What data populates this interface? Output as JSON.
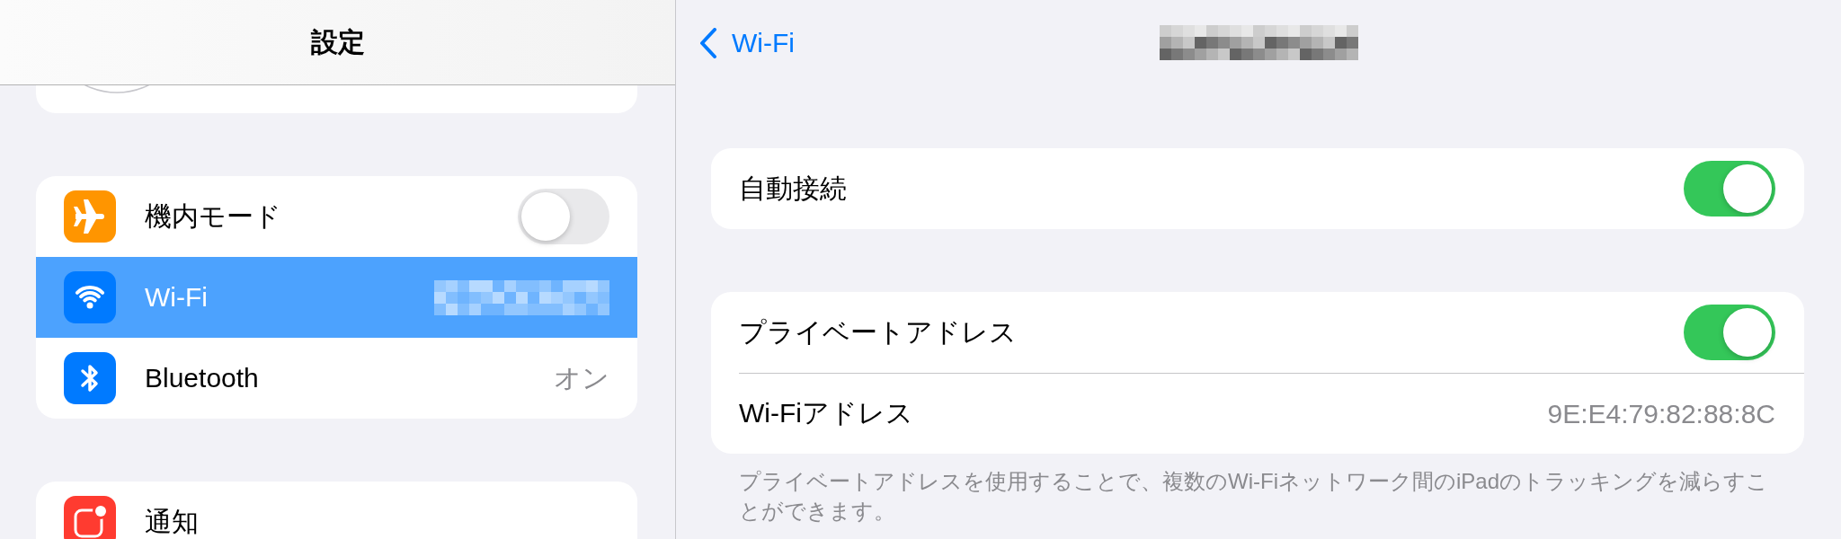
{
  "sidebar": {
    "title": "設定",
    "groups": [
      {
        "items": [
          {
            "kind": "toggle",
            "label": "機内モード",
            "color": "#ff9500",
            "on": false,
            "selected": false
          },
          {
            "kind": "link",
            "label": "Wi-Fi",
            "color": "#007aff",
            "value_blurred": true,
            "selected": true
          },
          {
            "kind": "link",
            "label": "Bluetooth",
            "color": "#007aff",
            "value": "オン",
            "selected": false
          }
        ]
      },
      {
        "items": [
          {
            "kind": "link",
            "label": "通知",
            "color": "#ff3b30",
            "selected": false
          }
        ]
      }
    ]
  },
  "detail": {
    "back": "Wi-Fi",
    "title_blurred": true,
    "groups": [
      {
        "rows": [
          {
            "kind": "toggle",
            "label": "自動接続",
            "on": true
          }
        ]
      },
      {
        "rows": [
          {
            "kind": "toggle",
            "label": "プライベートアドレス",
            "on": true
          },
          {
            "kind": "value",
            "label": "Wi-Fiアドレス",
            "value": "9E:E4:79:82:88:8C"
          }
        ],
        "footer": "プライベートアドレスを使用することで、複数のWi-Fiネットワーク間のiPadのトラッキングを減らすことができます。"
      }
    ]
  }
}
